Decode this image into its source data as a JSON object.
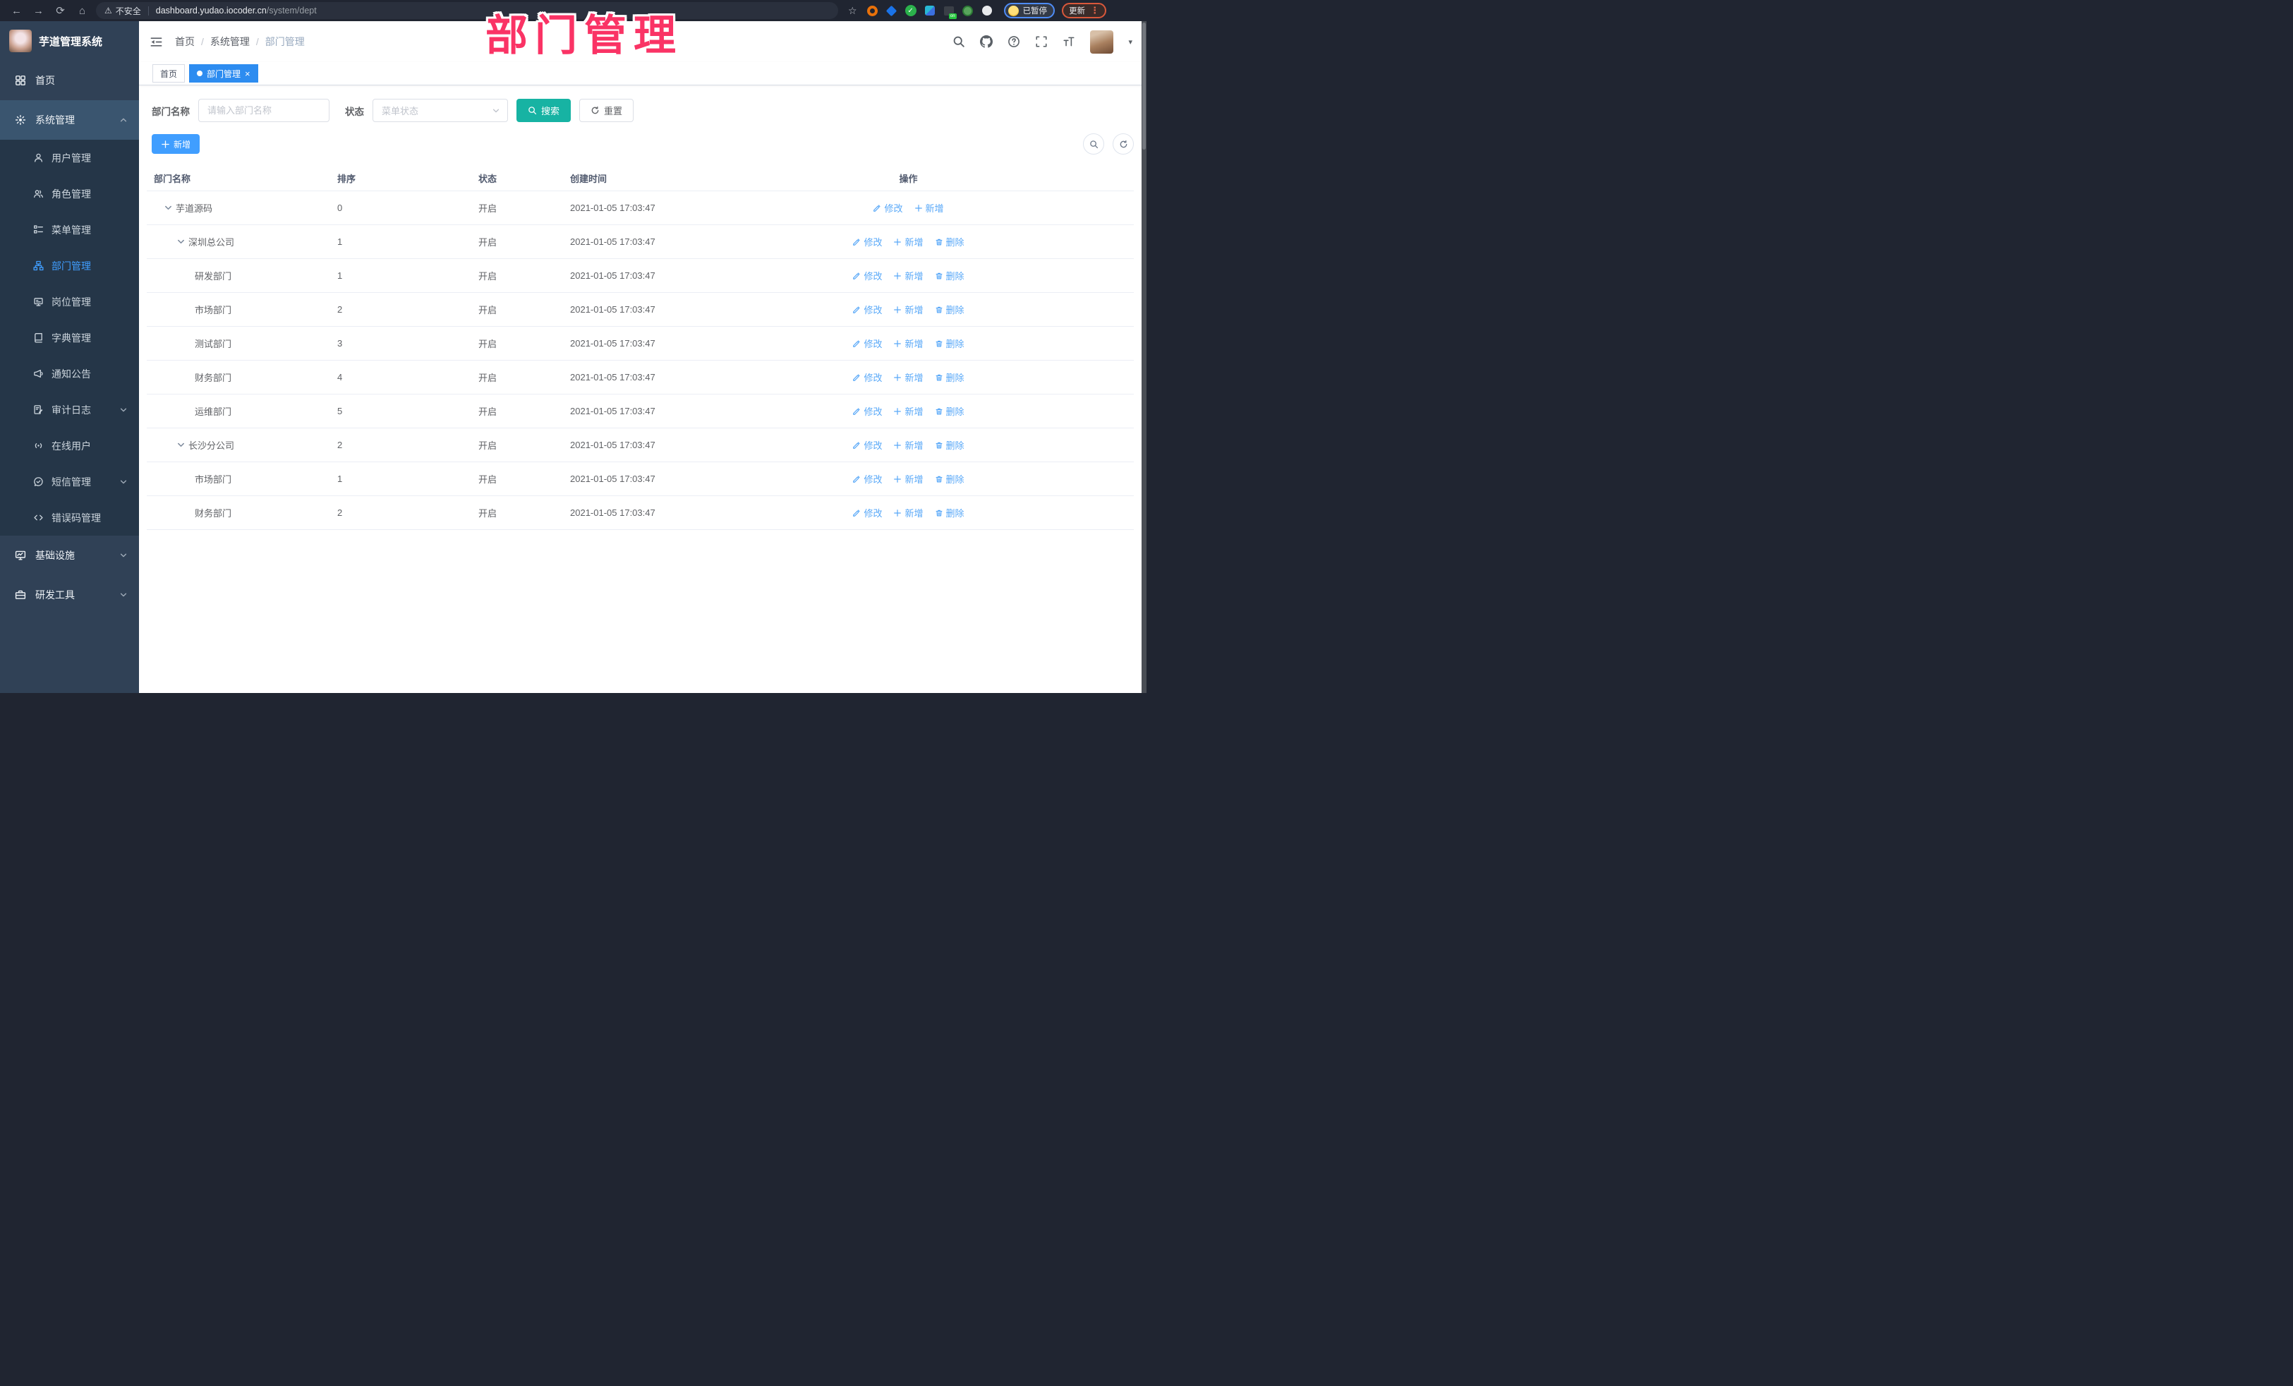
{
  "browser": {
    "back_icon": "←",
    "forward_icon": "→",
    "reload_icon": "⟳",
    "home_icon": "⌂",
    "warning_icon": "⚠",
    "security_label": "不安全",
    "url_host": "dashboard.yudao.iocoder.cn",
    "url_path": "/system/dept",
    "star_icon": "☆",
    "check_icon": "✓",
    "ext_on_badge": "on",
    "profile_status": "已暂停",
    "update_label": "更新",
    "menu_dots_icon": "⋮"
  },
  "overlay_title": "部门管理",
  "sidebar": {
    "logo_text": "芋道管理系统",
    "home_label": "首页",
    "system_label": "系统管理",
    "infra_label": "基础设施",
    "devtools_label": "研发工具",
    "system_children": [
      {
        "label": "用户管理"
      },
      {
        "label": "角色管理"
      },
      {
        "label": "菜单管理"
      },
      {
        "label": "部门管理"
      },
      {
        "label": "岗位管理"
      },
      {
        "label": "字典管理"
      },
      {
        "label": "通知公告"
      },
      {
        "label": "审计日志"
      },
      {
        "label": "在线用户"
      },
      {
        "label": "短信管理"
      },
      {
        "label": "错误码管理"
      }
    ]
  },
  "header": {
    "breadcrumb": [
      "首页",
      "系统管理",
      "部门管理"
    ],
    "separator": "/"
  },
  "tabs": {
    "home": "首页",
    "dept": "部门管理",
    "close_icon": "×"
  },
  "filters": {
    "name_label": "部门名称",
    "name_placeholder": "请输入部门名称",
    "status_label": "状态",
    "status_placeholder": "菜单状态",
    "search_label": "搜索",
    "reset_label": "重置"
  },
  "toolbar": {
    "add_label": "新增"
  },
  "table": {
    "columns": [
      "部门名称",
      "排序",
      "状态",
      "创建时间",
      "操作"
    ],
    "actions": {
      "edit": "修改",
      "add": "新增",
      "delete": "删除"
    },
    "rows": [
      {
        "name": "芋道源码",
        "order": "0",
        "status": "开启",
        "created": "2021-01-05 17:03:47",
        "level": 0,
        "expandable": true
      },
      {
        "name": "深圳总公司",
        "order": "1",
        "status": "开启",
        "created": "2021-01-05 17:03:47",
        "level": 1,
        "expandable": true
      },
      {
        "name": "研发部门",
        "order": "1",
        "status": "开启",
        "created": "2021-01-05 17:03:47",
        "level": 2
      },
      {
        "name": "市场部门",
        "order": "2",
        "status": "开启",
        "created": "2021-01-05 17:03:47",
        "level": 2
      },
      {
        "name": "测试部门",
        "order": "3",
        "status": "开启",
        "created": "2021-01-05 17:03:47",
        "level": 2
      },
      {
        "name": "财务部门",
        "order": "4",
        "status": "开启",
        "created": "2021-01-05 17:03:47",
        "level": 2
      },
      {
        "name": "运维部门",
        "order": "5",
        "status": "开启",
        "created": "2021-01-05 17:03:47",
        "level": 2
      },
      {
        "name": "长沙分公司",
        "order": "2",
        "status": "开启",
        "created": "2021-01-05 17:03:47",
        "level": 1,
        "expandable": true
      },
      {
        "name": "市场部门",
        "order": "1",
        "status": "开启",
        "created": "2021-01-05 17:03:47",
        "level": 2
      },
      {
        "name": "财务部门",
        "order": "2",
        "status": "开启",
        "created": "2021-01-05 17:03:47",
        "level": 2
      }
    ]
  },
  "colors": {
    "primary_blue": "#409eff",
    "tab_active_blue": "#2d8cf0",
    "search_teal": "#17b3a3",
    "action_link_blue": "#58a8f8",
    "overlay_pink": "#fa3365",
    "sidebar_bg": "#304156",
    "submenu_bg": "#253648",
    "active_menu_text": "#409eff"
  }
}
